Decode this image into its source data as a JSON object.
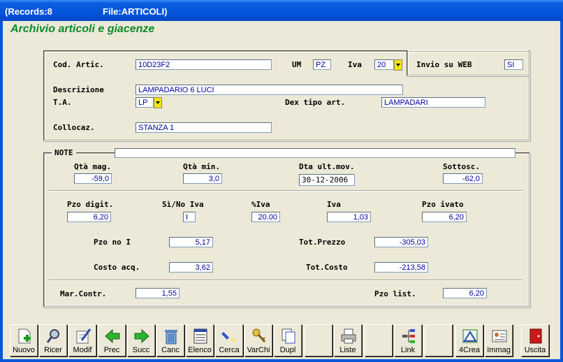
{
  "titlebar": {
    "records": "(Records:8",
    "file": "File:ARTICOLI)"
  },
  "heading": "Archivio articoli e giacenze",
  "top": {
    "cod_label": "Cod. Artic.",
    "cod_value": "10D23F2",
    "um_label": "UM",
    "um_value": "PZ",
    "iva_label": "Iva",
    "iva_value": "20",
    "web_label": "Invio su WEB",
    "web_value": "SI",
    "descr_label": "Descrizione",
    "descr_value": "LAMPADARIO 6 LUCI",
    "ta_label": "T.A.",
    "ta_value": "LP",
    "dex_label": "Dex tipo art.",
    "dex_value": "LAMPADARI",
    "colloc_label": "Collocaz.",
    "colloc_value": "STANZA 1"
  },
  "note": {
    "label": "NOTE",
    "value": "",
    "qta_mag_label": "Qtà mag.",
    "qta_mag": "-59,0",
    "qta_min_label": "Qtà min.",
    "qta_min": "3,0",
    "dta_label": "Dta ult.mov.",
    "dta": "30-12-2006",
    "sottosc_label": "Sottosc.",
    "sottosc": "-62,0",
    "pzo_digit_label": "Pzo digit.",
    "pzo_digit": "6,20",
    "sino_label": "Sì/No Iva",
    "sino": "I",
    "piva_label": "%Iva",
    "piva": "20.00",
    "iva_label": "Iva",
    "iva": "1,03",
    "pzo_ivato_label": "Pzo ivato",
    "pzo_ivato": "6,20",
    "pzo_noi_label": "Pzo no I",
    "pzo_noi": "5,17",
    "tot_prezzo_label": "Tot.Prezzo",
    "tot_prezzo": "-305,03",
    "costo_label": "Costo acq.",
    "costo": "3,62",
    "tot_costo_label": "Tot.Costo",
    "tot_costo": "-213,58",
    "mar_label": "Mar.Contr.",
    "mar": "1,55",
    "pzo_list_label": "Pzo list.",
    "pzo_list": "6,20"
  },
  "toolbar": [
    {
      "label": "Nuovo",
      "icon": "new-doc-icon"
    },
    {
      "label": "Ricer",
      "icon": "search-icon"
    },
    {
      "label": "Modif",
      "icon": "edit-icon"
    },
    {
      "label": "Prec",
      "icon": "arrow-left-icon"
    },
    {
      "label": "Succ",
      "icon": "arrow-right-icon"
    },
    {
      "label": "Canc",
      "icon": "trash-icon"
    },
    {
      "label": "Elenco",
      "icon": "list-icon"
    },
    {
      "label": "Cerca",
      "icon": "flashlight-icon"
    },
    {
      "label": "VarChi",
      "icon": "keys-icon"
    },
    {
      "label": "Dupl",
      "icon": "duplicate-icon"
    },
    {
      "label": "",
      "icon": ""
    },
    {
      "label": "Liste",
      "icon": "printer-icon"
    },
    {
      "label": "",
      "icon": ""
    },
    {
      "label": "Link",
      "icon": "network-icon"
    },
    {
      "label": "",
      "icon": ""
    },
    {
      "label": "4Crea",
      "icon": "design-icon"
    },
    {
      "label": "Immag",
      "icon": "image-card-icon"
    },
    {
      "label": "",
      "icon": ""
    },
    {
      "label": "Uscita",
      "icon": "exit-door-icon"
    }
  ],
  "colors": {
    "title_bar": "#0553D8",
    "heading": "#0A8A2A",
    "field_text": "#0000A0",
    "dropdown": "#F5E600"
  }
}
